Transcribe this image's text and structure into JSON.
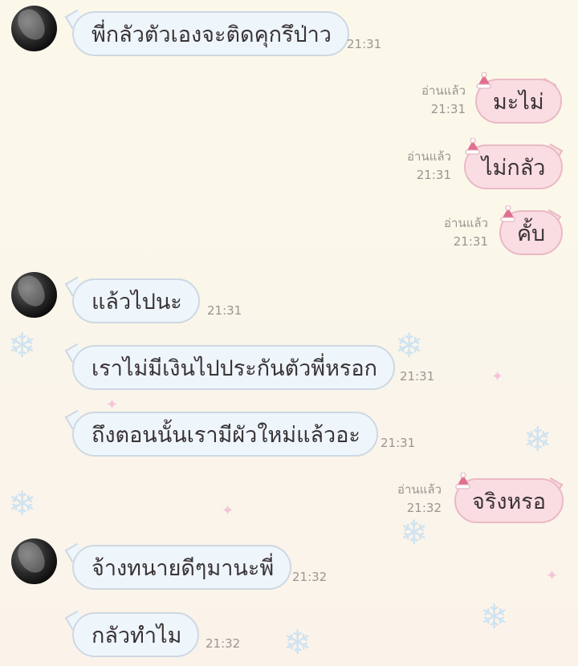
{
  "theme": {
    "incoming_bubble": "#eef6fb",
    "outgoing_bubble": "#f9dde3",
    "background": "#fbf8ea",
    "decoration_icon": "snowflake-icon"
  },
  "messages": [
    {
      "side": "in",
      "text": "พี่กลัวตัวเองจะติดคุกรึป่าว",
      "time": "21:31",
      "avatar": true
    },
    {
      "side": "out",
      "text": "มะไม่",
      "time": "21:31",
      "status": "อ่านแล้ว"
    },
    {
      "side": "out",
      "text": "ไม่กลัว",
      "time": "21:31",
      "status": "อ่านแล้ว"
    },
    {
      "side": "out",
      "text": "คั้บ",
      "time": "21:31",
      "status": "อ่านแล้ว"
    },
    {
      "side": "in",
      "text": "แล้วไปนะ",
      "time": "21:31",
      "avatar": true
    },
    {
      "side": "in",
      "text": "เราไม่มีเงินไปประกันตัวพี่หรอก",
      "time": "21:31"
    },
    {
      "side": "in",
      "text": "ถึงตอนนั้นเรามีผัวใหม่แล้วอะ",
      "time": "21:31"
    },
    {
      "side": "out",
      "text": "จริงหรอ",
      "time": "21:32",
      "status": "อ่านแล้ว"
    },
    {
      "side": "in",
      "text": "จ้างทนายดีๆมานะพี่",
      "time": "21:32",
      "avatar": true
    },
    {
      "side": "in",
      "text": "กลัวทำไม",
      "time": "21:32"
    }
  ]
}
